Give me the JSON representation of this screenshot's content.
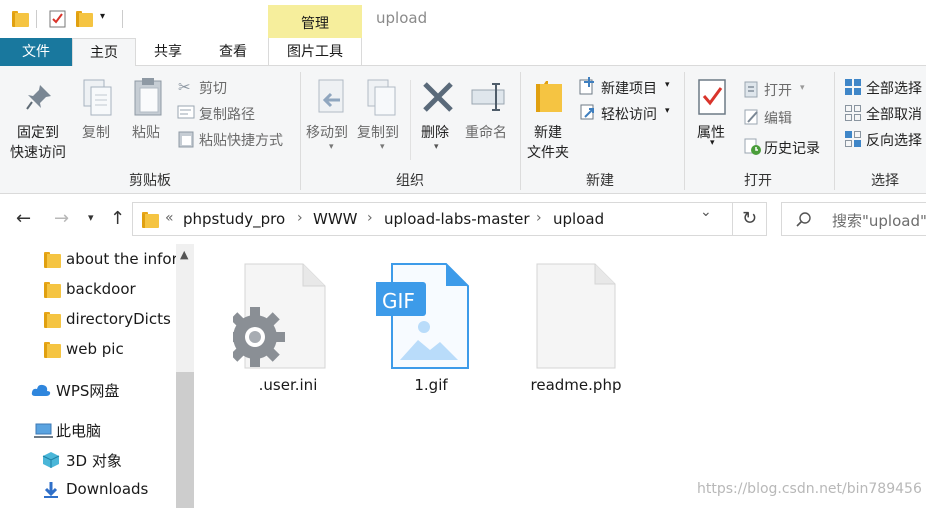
{
  "window": {
    "title": "upload",
    "context_tab_group": "管理"
  },
  "tabs": {
    "file": "文件",
    "home": "主页",
    "share": "共享",
    "view": "查看",
    "picture_tools": "图片工具"
  },
  "ribbon": {
    "clipboard": {
      "label": "剪贴板",
      "pin_line1": "固定到",
      "pin_line2": "快速访问",
      "copy": "复制",
      "paste": "粘贴",
      "cut": "剪切",
      "copy_path": "复制路径",
      "paste_shortcut": "粘贴快捷方式"
    },
    "organize": {
      "label": "组织",
      "move_to": "移动到",
      "copy_to": "复制到",
      "delete": "删除",
      "rename": "重命名"
    },
    "new": {
      "label": "新建",
      "new_folder_line1": "新建",
      "new_folder_line2": "文件夹",
      "new_item": "新建项目",
      "easy_access": "轻松访问"
    },
    "open": {
      "label": "打开",
      "properties": "属性",
      "open": "打开",
      "edit": "编辑",
      "history": "历史记录"
    },
    "select": {
      "label": "选择",
      "select_all": "全部选择",
      "select_none": "全部取消",
      "invert": "反向选择"
    }
  },
  "address": {
    "prefix": "«",
    "crumbs": [
      "phpstudy_pro",
      "WWW",
      "upload-labs-master",
      "upload"
    ],
    "search_placeholder": "搜索\"upload\""
  },
  "nav_pane": {
    "items": [
      {
        "label": "about the infor"
      },
      {
        "label": "backdoor"
      },
      {
        "label": "directoryDicts"
      },
      {
        "label": "web pic"
      },
      {
        "label": "WPS网盘"
      },
      {
        "label": "此电脑"
      },
      {
        "label": "3D 对象"
      },
      {
        "label": "Downloads"
      }
    ]
  },
  "files": [
    {
      "name": ".user.ini",
      "icon": "config-file-icon"
    },
    {
      "name": "1.gif",
      "icon": "gif-file-icon",
      "badge": "GIF"
    },
    {
      "name": "readme.php",
      "icon": "blank-file-icon"
    }
  ],
  "watermark": "https://blog.csdn.net/bin789456",
  "colors": {
    "file_tab": "#19789e",
    "manage_tab": "#f6ee9c",
    "folder": "#f5c442",
    "gif_blue": "#3d9be9"
  }
}
